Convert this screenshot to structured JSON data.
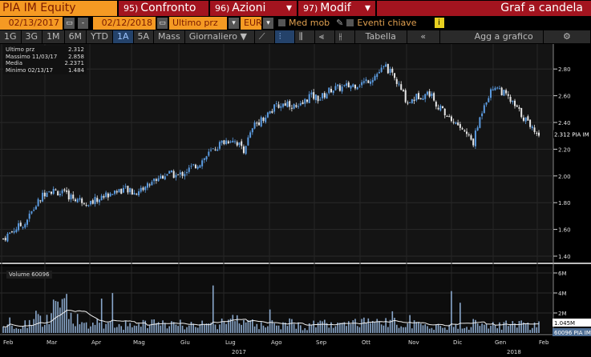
{
  "header": {
    "ticker": "PIA IM Equity",
    "btn1_num": "95)",
    "btn1": "Confronto",
    "btn2_num": "96)",
    "btn2": "Azioni",
    "btn3_num": "97)",
    "btn3": "Modif",
    "title": "Graf a candela"
  },
  "controls": {
    "start_date": "02/13/2017",
    "sep": "-",
    "end_date": "02/12/2018",
    "field": "Ultimo prz",
    "currency": "EUR",
    "med_mob": "Med mob",
    "eventi": "Eventi chiave",
    "info": "i"
  },
  "periods": [
    "1G",
    "3G",
    "1M",
    "6M",
    "YTD",
    "1A",
    "5A",
    "Mass"
  ],
  "selected_period": "1A",
  "frequency": "Giornaliero ▼",
  "toolbar": {
    "tabella": "Tabella",
    "collapse": "«",
    "agg": "Agg a grafico",
    "settings": "⚙"
  },
  "legend": [
    {
      "label": "Ultimo prz",
      "value": "2.312"
    },
    {
      "label": "Massimo 11/03/17",
      "value": "2.858"
    },
    {
      "label": "Media",
      "value": "2.2371"
    },
    {
      "label": "Minimo 02/13/17",
      "value": "1.484"
    }
  ],
  "volume_legend": "Volume 60096",
  "colors": {
    "up": "#5b9be0",
    "down": "#e8e8e8",
    "orange": "#f59a23",
    "red": "#a3141f"
  },
  "chart_data": {
    "type": "candlestick",
    "price_ticks": [
      "1.40",
      "1.60",
      "1.80",
      "2.00",
      "2.20",
      "2.40",
      "2.60",
      "2.80"
    ],
    "price_range": [
      1.4,
      2.9
    ],
    "last_price_label": "2.312 PIA IM",
    "volume_ticks": [
      "2M",
      "4M",
      "6M"
    ],
    "volume_range": [
      0,
      6.5
    ],
    "volume_avg_label": "1.045M",
    "volume_last_label": "60096 PIA IM",
    "months": [
      "Feb",
      "Mar",
      "Apr",
      "Mag",
      "Giu",
      "Lug",
      "Ago",
      "Sep",
      "Ott",
      "Nov",
      "Dic",
      "Gen",
      "Feb"
    ],
    "years": [
      "2017",
      "2018"
    ],
    "weekly_close": [
      1.53,
      1.6,
      1.65,
      1.78,
      1.9,
      1.88,
      1.85,
      1.82,
      1.8,
      1.84,
      1.88,
      1.9,
      1.87,
      1.92,
      1.98,
      2.02,
      2.0,
      2.05,
      2.1,
      2.18,
      2.25,
      2.28,
      2.2,
      2.38,
      2.45,
      2.52,
      2.55,
      2.5,
      2.6,
      2.58,
      2.65,
      2.66,
      2.68,
      2.7,
      2.75,
      2.82,
      2.7,
      2.55,
      2.6,
      2.62,
      2.5,
      2.42,
      2.35,
      2.25,
      2.55,
      2.68,
      2.6,
      2.5,
      2.4,
      2.31
    ],
    "weekly_volume_M": [
      0.7,
      0.6,
      0.9,
      1.4,
      2.2,
      2.8,
      1.6,
      1.0,
      0.9,
      0.8,
      0.9,
      0.8,
      0.9,
      1.0,
      0.8,
      1.1,
      0.9,
      1.0,
      0.8,
      0.7,
      1.2,
      1.3,
      0.9,
      0.7,
      0.8,
      0.9,
      1.0,
      0.7,
      0.8,
      0.9,
      0.7,
      0.8,
      0.9,
      1.0,
      0.9,
      1.1,
      0.9,
      0.8,
      0.7,
      0.6,
      0.6,
      0.7,
      0.6,
      0.9,
      0.8,
      0.7,
      0.8,
      0.9,
      0.7,
      0.8
    ]
  }
}
